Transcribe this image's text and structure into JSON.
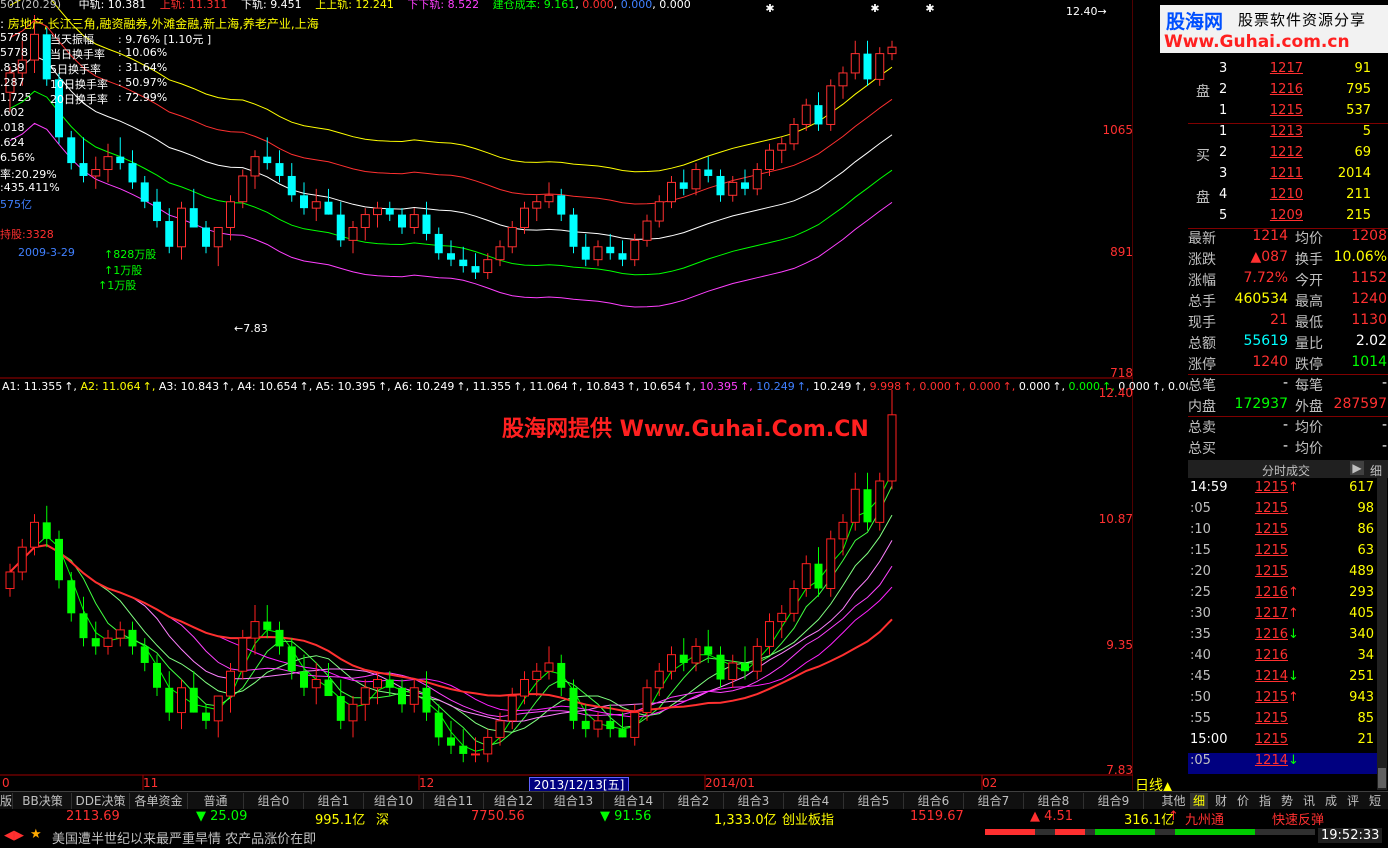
{
  "colors": {
    "up": "#ff3030",
    "down": "#00ffff",
    "grid": "#800000",
    "neutral": "#c0c0c0",
    "yellow": "#ffff00"
  },
  "top_line": {
    "a": "501(20.29)",
    "mid_label": "中轨",
    "mid": "10.381",
    "upper_label": "上轨",
    "upper": "11.311",
    "lower_label": "下轨",
    "lower": "9.451",
    "upper2_label": "上上轨",
    "upper2": "12.241",
    "lower2_label": "下下轨",
    "lower2": "8.522",
    "cost_label": "建仓成本",
    "cost": "9.161",
    "z1": "0.000",
    "z2": "0.000",
    "z3": "0.000"
  },
  "sector_line": "房地产,长江三角,融资融券,外滩金融,新上海,养老产业,上海",
  "left_vals": [
    "5778",
    "5778",
    ".839",
    ".287",
    "1.725",
    ".602",
    ".018",
    ".624",
    "6.56%",
    "率:20.29%",
    ":435.411%",
    "575亿",
    "持股:3328"
  ],
  "info_stats": [
    {
      "label": "当天振幅",
      "value": ": 9.76% [1.10元 ]"
    },
    {
      "label": "当日换手率",
      "value": ": 10.06%"
    },
    {
      "label": "5日换手率",
      "value": ": 31.64%"
    },
    {
      "label": "10日换手率",
      "value": ": 50.97%"
    },
    {
      "label": "20日换手率",
      "value": ": 72.99%"
    }
  ],
  "annotations": {
    "date": "2009-3-29",
    "a1": "828万股",
    "a2": "1万股",
    "a3": "1万股",
    "low": "7.83",
    "high": "12.40"
  },
  "indicator_line": [
    {
      "text": "A1: 11.355",
      "color": "#ffffff"
    },
    {
      "text": "A2: 11.064",
      "color": "#ffff00"
    },
    {
      "text": "A3: 10.843",
      "color": "#ffffff"
    },
    {
      "text": "A4: 10.654",
      "color": "#ffffff"
    },
    {
      "text": "A5: 10.395",
      "color": "#ffffff"
    },
    {
      "text": "A6: 10.249",
      "color": "#ffffff"
    },
    {
      "text": "11.355",
      "color": "#ffffff"
    },
    {
      "text": "11.064",
      "color": "#ffffff"
    },
    {
      "text": "10.843",
      "color": "#ffffff"
    },
    {
      "text": "10.654",
      "color": "#ffffff"
    },
    {
      "text": "10.395",
      "color": "#ff40ff"
    },
    {
      "text": "10.249",
      "color": "#4080ff"
    },
    {
      "text": "10.249",
      "color": "#ffffff"
    },
    {
      "text": "9.998",
      "color": "#ff3030"
    },
    {
      "text": "0.000",
      "color": "#ff3030"
    },
    {
      "text": "0.000",
      "color": "#ff3030"
    },
    {
      "text": "0.000",
      "color": "#ffffff"
    },
    {
      "text": "0.000",
      "color": "#00ff00"
    },
    {
      "text": "0.000",
      "color": "#ffffff"
    },
    {
      "text": "0.000",
      "color": "#ffffff"
    },
    {
      "text": "0.",
      "color": "#ffffff"
    }
  ],
  "watermark": "股海网提供 Www.Guhai.Com.CN",
  "y_axis_upper": [
    "1065",
    "891",
    "718"
  ],
  "y_axis_lower": [
    "12.40",
    "10.87",
    "9.35",
    "7.83"
  ],
  "x_axis": {
    "l0": "0",
    "l1": "11",
    "l2": "12",
    "date_box": "2013/12/13[五]",
    "l3": "2014/01",
    "l4": "02"
  },
  "period": "日线",
  "logo": {
    "a": "股海网",
    "b": "股票软件资源分享",
    "c": "Www.Guhai.com.cn"
  },
  "sell_label": "卖",
  "sell_side": "盘",
  "buy_label": "买",
  "buy_side": "盘",
  "orderbook_sell": [
    {
      "level": "3",
      "price": "1217",
      "vol": "91"
    },
    {
      "level": "2",
      "price": "1216",
      "vol": "795"
    },
    {
      "level": "1",
      "price": "1215",
      "vol": "537"
    }
  ],
  "orderbook_buy": [
    {
      "level": "1",
      "price": "1213",
      "vol": "5"
    },
    {
      "level": "2",
      "price": "1212",
      "vol": "69"
    },
    {
      "level": "3",
      "price": "1211",
      "vol": "2014"
    },
    {
      "level": "4",
      "price": "1210",
      "vol": "211"
    },
    {
      "level": "5",
      "price": "1209",
      "vol": "215"
    }
  ],
  "quotes": [
    {
      "l1": "最新",
      "v1": "1214",
      "c1": "#ff3030",
      "l2": "均价",
      "v2": "1208",
      "c2": "#ff3030"
    },
    {
      "l1": "涨跌",
      "v1": "▲087",
      "c1": "#ff3030",
      "l2": "换手",
      "v2": "10.06%",
      "c2": "#ffff00"
    },
    {
      "l1": "涨幅",
      "v1": "7.72%",
      "c1": "#ff3030",
      "l2": "今开",
      "v2": "1152",
      "c2": "#ff3030"
    },
    {
      "l1": "总手",
      "v1": "460534",
      "c1": "#ffff00",
      "l2": "最高",
      "v2": "1240",
      "c2": "#ff3030"
    },
    {
      "l1": "现手",
      "v1": "21",
      "c1": "#ff3030",
      "l2": "最低",
      "v2": "1130",
      "c2": "#ff3030"
    },
    {
      "l1": "总额",
      "v1": "55619",
      "c1": "#00ffff",
      "l2": "量比",
      "v2": "2.02",
      "c2": "#ffffff"
    },
    {
      "l1": "涨停",
      "v1": "1240",
      "c1": "#ff3030",
      "l2": "跌停",
      "v2": "1014",
      "c2": "#00ff00"
    },
    {
      "l1": "总笔",
      "v1": "-",
      "c1": "#ffffff",
      "l2": "每笔",
      "v2": "-",
      "c2": "#ffffff"
    },
    {
      "l1": "内盘",
      "v1": "172937",
      "c1": "#00ff00",
      "l2": "外盘",
      "v2": "287597",
      "c2": "#ff3030"
    },
    {
      "l1": "总卖",
      "v1": "-",
      "c1": "#ffffff",
      "l2": "均价",
      "v2": "-",
      "c2": "#ffffff"
    },
    {
      "l1": "总买",
      "v1": "-",
      "c1": "#ffffff",
      "l2": "均价",
      "v2": "-",
      "c2": "#ffffff"
    }
  ],
  "tick_header": "分时成交",
  "tick_header_btn": "▶",
  "tick_header_tab": "细",
  "ticks": [
    {
      "time": "14:59",
      "price": "1215",
      "arrow": "↑",
      "arrow_color": "#ff3030",
      "vol": "617"
    },
    {
      "time": ":05",
      "price": "1215",
      "arrow": "",
      "arrow_color": "#ff3030",
      "vol": "98"
    },
    {
      "time": ":10",
      "price": "1215",
      "arrow": "",
      "arrow_color": "#ff3030",
      "vol": "86"
    },
    {
      "time": ":15",
      "price": "1215",
      "arrow": "",
      "arrow_color": "#ff3030",
      "vol": "63"
    },
    {
      "time": ":20",
      "price": "1215",
      "arrow": "",
      "arrow_color": "#ff3030",
      "vol": "489"
    },
    {
      "time": ":25",
      "price": "1216",
      "arrow": "↑",
      "arrow_color": "#ff3030",
      "vol": "293"
    },
    {
      "time": ":30",
      "price": "1217",
      "arrow": "↑",
      "arrow_color": "#ff3030",
      "vol": "405"
    },
    {
      "time": ":35",
      "price": "1216",
      "arrow": "↓",
      "arrow_color": "#00ff00",
      "vol": "340"
    },
    {
      "time": ":40",
      "price": "1216",
      "arrow": "",
      "arrow_color": "#ff3030",
      "vol": "34"
    },
    {
      "time": ":45",
      "price": "1214",
      "arrow": "↓",
      "arrow_color": "#00ff00",
      "vol": "251"
    },
    {
      "time": ":50",
      "price": "1215",
      "arrow": "↑",
      "arrow_color": "#ff3030",
      "vol": "943"
    },
    {
      "time": ":55",
      "price": "1215",
      "arrow": "",
      "arrow_color": "#ff3030",
      "vol": "85"
    },
    {
      "time": "15:00",
      "price": "1215",
      "arrow": "",
      "arrow_color": "#ff3030",
      "vol": "21"
    },
    {
      "time": ":05",
      "price": "1214",
      "arrow": "↓",
      "arrow_color": "#00ff00",
      "vol": ""
    }
  ],
  "tabs": [
    "BB决策",
    "DDE决策",
    "各单资金",
    "普通",
    "组合0",
    "组合1",
    "组合10",
    "组合11",
    "组合12",
    "组合13",
    "组合14",
    "组合2",
    "组合3",
    "组合4",
    "组合5",
    "组合6",
    "组合7",
    "组合8",
    "组合9",
    "其他"
  ],
  "tab_first": "版",
  "right_tabs": [
    "细",
    "财",
    "价",
    "指",
    "势",
    "讯",
    "成",
    "评",
    "短"
  ],
  "status": {
    "sh_index": "2113.69",
    "sh_change": "▼ 25.09",
    "sh_amount": "995.1亿",
    "sz_label": "深",
    "sz_index": "7750.56",
    "sz_change": "▼ 91.56",
    "sz_amount": "1,333.0亿",
    "cy_label": "创业板指",
    "cy_index": "1519.67",
    "cy_change": "▲ 4.51",
    "cy_amount": "316.1亿",
    "news_marker": "↑",
    "news1": "九州通",
    "news2": "快速反弹",
    "ticker_text": "美国遭半世纪以来最严重旱情 农产品涨价在即",
    "clock": "19:52:33",
    "nav_arrows": "◀▶",
    "star": "★"
  },
  "chart_data": {
    "type": "candlestick",
    "x_axis_labels": [
      "0",
      "11",
      "12",
      "2013/12/13[五]",
      "2014/01",
      "02"
    ],
    "upper_panel_y_ticks": [
      1065,
      891,
      718
    ],
    "upper_panel_high_label": 12.4,
    "upper_panel_low_label": 7.83,
    "lower_panel_y_ticks": [
      12.4,
      10.87,
      9.35,
      7.83
    ],
    "upper_candles": [
      [
        11.6,
        12.0,
        11.3,
        11.9
      ],
      [
        11.9,
        12.4,
        11.7,
        12.1
      ],
      [
        12.1,
        12.8,
        11.9,
        12.5
      ],
      [
        12.5,
        12.6,
        11.7,
        11.8
      ],
      [
        11.8,
        11.9,
        10.8,
        10.9
      ],
      [
        10.9,
        11.0,
        10.4,
        10.5
      ],
      [
        10.5,
        10.9,
        10.2,
        10.3
      ],
      [
        10.3,
        10.6,
        10.1,
        10.4
      ],
      [
        10.4,
        10.8,
        10.2,
        10.6
      ],
      [
        10.6,
        10.9,
        10.4,
        10.5
      ],
      [
        10.5,
        10.7,
        10.1,
        10.2
      ],
      [
        10.2,
        10.3,
        9.8,
        9.9
      ],
      [
        9.9,
        10.1,
        9.5,
        9.6
      ],
      [
        9.6,
        9.8,
        9.1,
        9.2
      ],
      [
        9.2,
        9.9,
        9.0,
        9.8
      ],
      [
        9.8,
        10.1,
        9.5,
        9.5
      ],
      [
        9.5,
        9.6,
        9.1,
        9.2
      ],
      [
        9.2,
        9.5,
        8.9,
        9.5
      ],
      [
        9.5,
        10.0,
        9.3,
        9.9
      ],
      [
        9.9,
        10.4,
        9.8,
        10.3
      ],
      [
        10.3,
        10.7,
        10.1,
        10.6
      ],
      [
        10.6,
        10.9,
        10.4,
        10.5
      ],
      [
        10.5,
        10.7,
        10.2,
        10.3
      ],
      [
        10.3,
        10.5,
        9.9,
        10.0
      ],
      [
        10.0,
        10.2,
        9.7,
        9.8
      ],
      [
        9.8,
        10.1,
        9.6,
        9.9
      ],
      [
        9.9,
        10.1,
        9.7,
        9.7
      ],
      [
        9.7,
        9.9,
        9.2,
        9.3
      ],
      [
        9.3,
        9.6,
        9.1,
        9.5
      ],
      [
        9.5,
        9.8,
        9.3,
        9.7
      ],
      [
        9.7,
        9.9,
        9.5,
        9.8
      ],
      [
        9.8,
        9.9,
        9.6,
        9.7
      ],
      [
        9.7,
        9.8,
        9.4,
        9.5
      ],
      [
        9.5,
        9.8,
        9.4,
        9.7
      ],
      [
        9.7,
        9.9,
        9.3,
        9.4
      ],
      [
        9.4,
        9.5,
        9.0,
        9.1
      ],
      [
        9.1,
        9.3,
        8.9,
        9.0
      ],
      [
        9.0,
        9.2,
        8.8,
        8.9
      ],
      [
        8.9,
        9.1,
        8.7,
        8.8
      ],
      [
        8.8,
        9.1,
        8.7,
        9.0
      ],
      [
        9.0,
        9.3,
        8.9,
        9.2
      ],
      [
        9.2,
        9.6,
        9.1,
        9.5
      ],
      [
        9.5,
        9.9,
        9.4,
        9.8
      ],
      [
        9.8,
        10.0,
        9.6,
        9.9
      ],
      [
        9.9,
        10.2,
        9.8,
        10.0
      ],
      [
        10.0,
        10.1,
        9.6,
        9.7
      ],
      [
        9.7,
        9.8,
        9.1,
        9.2
      ],
      [
        9.2,
        9.4,
        8.9,
        9.0
      ],
      [
        9.0,
        9.3,
        8.9,
        9.2
      ],
      [
        9.2,
        9.4,
        9.0,
        9.1
      ],
      [
        9.1,
        9.3,
        8.9,
        9.0
      ],
      [
        9.0,
        9.4,
        8.9,
        9.3
      ],
      [
        9.3,
        9.7,
        9.2,
        9.6
      ],
      [
        9.6,
        10.0,
        9.5,
        9.9
      ],
      [
        9.9,
        10.3,
        9.8,
        10.2
      ],
      [
        10.2,
        10.4,
        10.0,
        10.1
      ],
      [
        10.1,
        10.5,
        10.0,
        10.4
      ],
      [
        10.4,
        10.6,
        10.2,
        10.3
      ],
      [
        10.3,
        10.4,
        9.9,
        10.0
      ],
      [
        10.0,
        10.3,
        9.9,
        10.2
      ],
      [
        10.2,
        10.4,
        10.0,
        10.1
      ],
      [
        10.1,
        10.5,
        10.0,
        10.4
      ],
      [
        10.4,
        10.8,
        10.3,
        10.7
      ],
      [
        10.7,
        10.9,
        10.5,
        10.8
      ],
      [
        10.8,
        11.2,
        10.7,
        11.1
      ],
      [
        11.1,
        11.5,
        11.0,
        11.4
      ],
      [
        11.4,
        11.6,
        11.0,
        11.1
      ],
      [
        11.1,
        11.8,
        11.0,
        11.7
      ],
      [
        11.7,
        12.0,
        11.5,
        11.9
      ],
      [
        11.9,
        12.4,
        11.8,
        12.2
      ],
      [
        12.2,
        12.4,
        11.7,
        11.8
      ],
      [
        11.8,
        12.3,
        11.7,
        12.2
      ],
      [
        12.2,
        12.4,
        12.1,
        12.3
      ]
    ],
    "lower_candles": [
      [
        10.0,
        10.3,
        9.9,
        10.2
      ],
      [
        10.2,
        10.6,
        10.1,
        10.5
      ],
      [
        10.5,
        10.9,
        10.4,
        10.8
      ],
      [
        10.8,
        11.0,
        10.5,
        10.6
      ],
      [
        10.6,
        10.7,
        10.0,
        10.1
      ],
      [
        10.1,
        10.2,
        9.6,
        9.7
      ],
      [
        9.7,
        9.9,
        9.3,
        9.4
      ],
      [
        9.4,
        9.6,
        9.2,
        9.3
      ],
      [
        9.3,
        9.5,
        9.2,
        9.4
      ],
      [
        9.4,
        9.6,
        9.3,
        9.5
      ],
      [
        9.5,
        9.6,
        9.2,
        9.3
      ],
      [
        9.3,
        9.4,
        9.0,
        9.1
      ],
      [
        9.1,
        9.2,
        8.7,
        8.8
      ],
      [
        8.8,
        9.0,
        8.4,
        8.5
      ],
      [
        8.5,
        8.9,
        8.3,
        8.8
      ],
      [
        8.8,
        9.0,
        8.5,
        8.5
      ],
      [
        8.5,
        8.6,
        8.3,
        8.4
      ],
      [
        8.4,
        8.7,
        8.2,
        8.7
      ],
      [
        8.7,
        9.1,
        8.5,
        9.0
      ],
      [
        9.0,
        9.5,
        8.9,
        9.4
      ],
      [
        9.4,
        9.8,
        9.2,
        9.6
      ],
      [
        9.6,
        9.8,
        9.4,
        9.5
      ],
      [
        9.5,
        9.6,
        9.2,
        9.3
      ],
      [
        9.3,
        9.4,
        8.9,
        9.0
      ],
      [
        9.0,
        9.2,
        8.7,
        8.8
      ],
      [
        8.8,
        9.1,
        8.6,
        8.9
      ],
      [
        8.9,
        9.1,
        8.7,
        8.7
      ],
      [
        8.7,
        8.9,
        8.3,
        8.4
      ],
      [
        8.4,
        8.7,
        8.2,
        8.6
      ],
      [
        8.6,
        8.9,
        8.4,
        8.8
      ],
      [
        8.8,
        9.0,
        8.6,
        8.9
      ],
      [
        8.9,
        9.0,
        8.7,
        8.8
      ],
      [
        8.8,
        8.9,
        8.5,
        8.6
      ],
      [
        8.6,
        8.9,
        8.5,
        8.8
      ],
      [
        8.8,
        9.0,
        8.4,
        8.5
      ],
      [
        8.5,
        8.6,
        8.1,
        8.2
      ],
      [
        8.2,
        8.4,
        8.0,
        8.1
      ],
      [
        8.1,
        8.3,
        7.9,
        8.0
      ],
      [
        8.0,
        8.2,
        7.9,
        8.0
      ],
      [
        8.0,
        8.3,
        7.9,
        8.2
      ],
      [
        8.2,
        8.5,
        8.1,
        8.4
      ],
      [
        8.4,
        8.8,
        8.3,
        8.7
      ],
      [
        8.7,
        9.0,
        8.6,
        8.9
      ],
      [
        8.9,
        9.1,
        8.7,
        9.0
      ],
      [
        9.0,
        9.3,
        8.9,
        9.1
      ],
      [
        9.1,
        9.2,
        8.7,
        8.8
      ],
      [
        8.8,
        8.9,
        8.3,
        8.4
      ],
      [
        8.4,
        8.6,
        8.2,
        8.3
      ],
      [
        8.3,
        8.5,
        8.2,
        8.4
      ],
      [
        8.4,
        8.6,
        8.2,
        8.3
      ],
      [
        8.3,
        8.5,
        8.2,
        8.2
      ],
      [
        8.2,
        8.6,
        8.1,
        8.5
      ],
      [
        8.5,
        8.9,
        8.4,
        8.8
      ],
      [
        8.8,
        9.1,
        8.7,
        9.0
      ],
      [
        9.0,
        9.3,
        8.9,
        9.2
      ],
      [
        9.2,
        9.4,
        9.0,
        9.1
      ],
      [
        9.1,
        9.4,
        9.0,
        9.3
      ],
      [
        9.3,
        9.5,
        9.1,
        9.2
      ],
      [
        9.2,
        9.3,
        8.8,
        8.9
      ],
      [
        8.9,
        9.2,
        8.8,
        9.1
      ],
      [
        9.1,
        9.3,
        8.9,
        9.0
      ],
      [
        9.0,
        9.4,
        8.9,
        9.3
      ],
      [
        9.3,
        9.7,
        9.2,
        9.6
      ],
      [
        9.6,
        9.8,
        9.4,
        9.7
      ],
      [
        9.7,
        10.1,
        9.6,
        10.0
      ],
      [
        10.0,
        10.4,
        9.9,
        10.3
      ],
      [
        10.3,
        10.5,
        9.9,
        10.0
      ],
      [
        10.0,
        10.7,
        9.9,
        10.6
      ],
      [
        10.6,
        10.9,
        10.4,
        10.8
      ],
      [
        10.8,
        11.4,
        10.7,
        11.2
      ],
      [
        11.2,
        11.4,
        10.7,
        10.8
      ],
      [
        10.8,
        11.4,
        10.7,
        11.3
      ],
      [
        11.3,
        12.4,
        11.2,
        12.1
      ]
    ]
  }
}
